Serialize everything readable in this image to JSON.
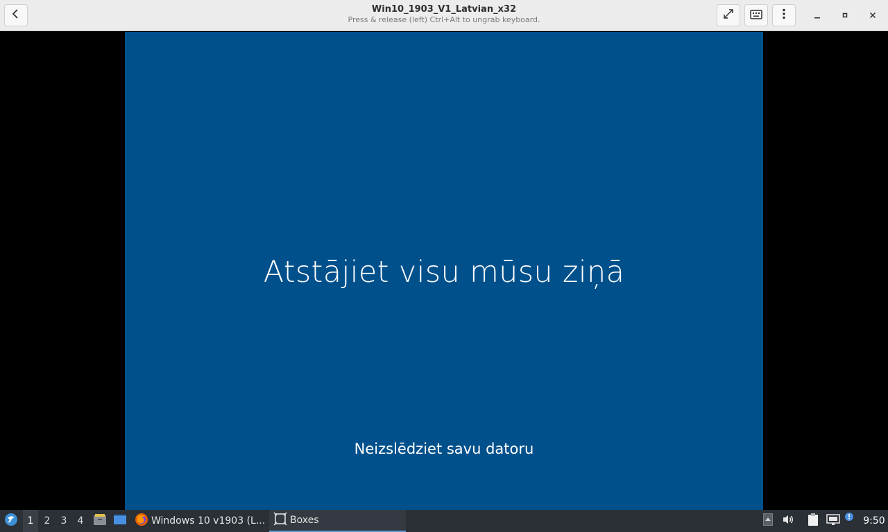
{
  "window": {
    "title": "Win10_1903_V1_Latvian_x32",
    "subtitle": "Press & release (left) Ctrl+Alt to ungrab keyboard."
  },
  "headerbar": {
    "back_icon": "chevron-left-icon",
    "fullscreen_icon": "expand-icon",
    "keyboard_icon": "keyboard-icon",
    "menu_icon": "vertical-ellipsis-icon",
    "minimize_icon": "minimize-icon",
    "maximize_icon": "maximize-icon",
    "close_icon": "close-icon"
  },
  "vm": {
    "background": "#00508c",
    "heading": "Atstājiet visu mūsu ziņā",
    "subheading": "Neizslēdziet savu datoru"
  },
  "taskbar": {
    "workspaces": [
      "1",
      "2",
      "3",
      "4"
    ],
    "active_workspace": "1",
    "tasks": [
      {
        "label": "Windows 10 v1903 (L...",
        "icon": "firefox-icon"
      },
      {
        "label": "Boxes",
        "icon": "boxes-icon",
        "active": true
      }
    ],
    "clock": "9:50"
  }
}
